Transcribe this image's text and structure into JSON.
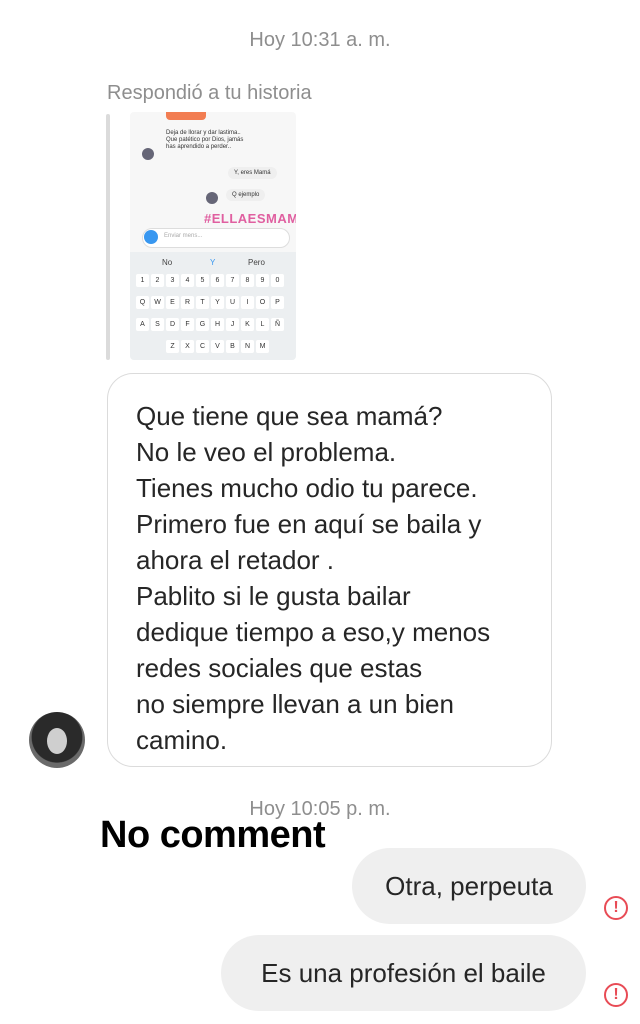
{
  "timestamp_1": "Hoy 10:31 a. m.",
  "story_reply_label": "Respondió a tu historia",
  "story_preview": {
    "lines": [
      "Deja de llorar y dar lastima..",
      "Que patético por Dios, jamás",
      "has aprendido a perder.."
    ],
    "bubble_1": "Y, eres Mamá",
    "bubble_2": "Q ejemplo",
    "hashtag": "#ELLAESMAMA",
    "input_placeholder": "Enviar mens...",
    "suggestions": [
      "No",
      "Y",
      "Pero"
    ],
    "row1": [
      "1",
      "2",
      "3",
      "4",
      "5",
      "6",
      "7",
      "8",
      "9",
      "0"
    ],
    "row2": [
      "Q",
      "W",
      "E",
      "R",
      "T",
      "Y",
      "U",
      "I",
      "O",
      "P"
    ],
    "row3": [
      "A",
      "S",
      "D",
      "F",
      "G",
      "H",
      "J",
      "K",
      "L",
      "Ñ"
    ],
    "row4": [
      "Z",
      "X",
      "C",
      "V",
      "B",
      "N",
      "M"
    ]
  },
  "message_in": {
    "lines": [
      "Que tiene que sea mamá?",
      "No le veo el problema.",
      "Tienes mucho odio tu parece.",
      "Primero fue en aquí se baila y",
      "ahora el retador .",
      "Pablito si le gusta bailar",
      "dedique tiempo a eso,y menos",
      "redes sociales que estas",
      "no siempre llevan a un bien",
      "camino."
    ]
  },
  "timestamp_2": "Hoy 10:05 p. m.",
  "overlay_caption": "No comment",
  "messages_out": [
    {
      "text": "Otra, perpeuta",
      "status_icon": "error-icon"
    },
    {
      "text": "Es una profesión el baile",
      "status_icon": "error-icon"
    }
  ],
  "colors": {
    "error": "#e84b55",
    "bubble_out": "#efefef",
    "timestamp": "#8e8e8e",
    "hashtag": "#e05fa0"
  }
}
